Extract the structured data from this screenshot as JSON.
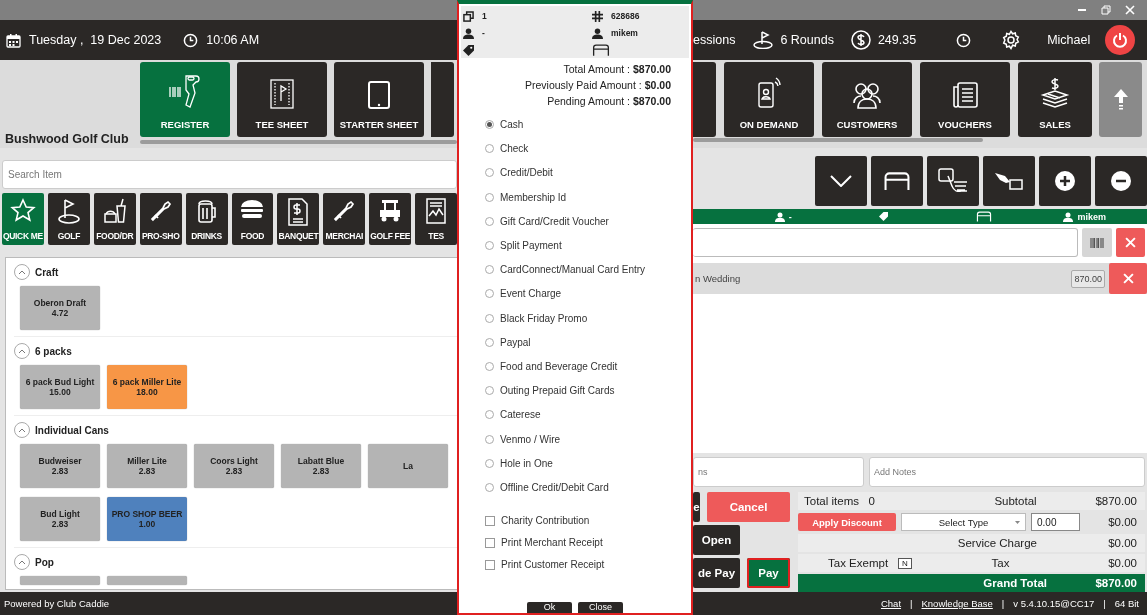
{
  "top_bar": {
    "date": "Tuesday ,  19 Dec 2023",
    "time": "10:06 AM",
    "sessions": "essions",
    "rounds": "6 Rounds",
    "balance": "249.35",
    "user": "Michael"
  },
  "club_name": "Bushwood Golf Club",
  "nav_left": [
    {
      "label": "REGISTER",
      "selected": true
    },
    {
      "label": "TEE SHEET",
      "selected": false
    },
    {
      "label": "STARTER SHEET",
      "selected": false
    }
  ],
  "nav_right": [
    {
      "label": "ON DEMAND",
      "selected": false
    },
    {
      "label": "CUSTOMERS",
      "selected": false
    },
    {
      "label": "VOUCHERS",
      "selected": false
    },
    {
      "label": "SALES",
      "selected": false
    }
  ],
  "search": {
    "placeholder": "Search Item"
  },
  "categories": [
    {
      "label": "QUICK ME",
      "selected": true
    },
    {
      "label": "GOLF",
      "selected": false
    },
    {
      "label": "FOOD/DR",
      "selected": false
    },
    {
      "label": "PRO-SHO",
      "selected": false
    },
    {
      "label": "DRINKS",
      "selected": false
    },
    {
      "label": "FOOD",
      "selected": false
    },
    {
      "label": "BANQUET",
      "selected": false
    },
    {
      "label": "MERCHAI",
      "selected": false
    },
    {
      "label": "GOLF FEE",
      "selected": false
    },
    {
      "label": "TES",
      "selected": false
    }
  ],
  "sections": [
    {
      "title": "Craft",
      "expanded": true,
      "items": [
        {
          "name": "Oberon Draft",
          "price": "4.72",
          "color": "#b4b4b4"
        }
      ]
    },
    {
      "title": "6 packs",
      "expanded": true,
      "items": [
        {
          "name": "6 pack Bud Light",
          "price": "15.00",
          "color": "#b4b4b4"
        },
        {
          "name": "6 pack Miller Lite",
          "price": "18.00",
          "color": "#f79646"
        }
      ]
    },
    {
      "title": "Individual Cans",
      "expanded": true,
      "items": [
        {
          "name": "Budweiser",
          "price": "2.83",
          "color": "#b4b4b4"
        },
        {
          "name": "Miller Lite",
          "price": "2.83",
          "color": "#b4b4b4"
        },
        {
          "name": "Coors Light",
          "price": "2.83",
          "color": "#b4b4b4"
        },
        {
          "name": "Labatt Blue",
          "price": "2.83",
          "color": "#b4b4b4"
        },
        {
          "name": "La",
          "color": "#b4b4b4"
        },
        {
          "name": "Bud Light",
          "price": "2.83",
          "color": "#b4b4b4"
        },
        {
          "name": "PRO SHOP BEER",
          "price": "1.00",
          "color": "#4f81bd"
        }
      ]
    },
    {
      "title": "Pop",
      "expanded": true,
      "items": [
        {
          "color": "#b4b4b4"
        },
        {
          "color": "#b4b4b4"
        }
      ]
    }
  ],
  "ticket_bar": {
    "customer": "-",
    "staff": "mikem"
  },
  "order_lines": [
    {
      "name": "n Wedding",
      "amount": "870.00"
    }
  ],
  "notes": [
    {
      "placeholder": "ns"
    },
    {
      "placeholder": "Add Notes"
    }
  ],
  "actions": [
    {
      "label": "e",
      "kind": "dark",
      "focused": false
    },
    {
      "label": "Cancel",
      "kind": "danger",
      "focused": false
    },
    {
      "label": "Open",
      "kind": "dark",
      "focused": false
    },
    {
      "label": "de Pay",
      "kind": "dark",
      "focused": false
    },
    {
      "label": "Pay",
      "kind": "primary",
      "focused": true
    }
  ],
  "summary": {
    "total_items_label": "Total items",
    "total_items": "0",
    "subtotal_label": "Subtotal",
    "subtotal": "$870.00",
    "discount_button": "Apply Discount",
    "discount_type": "Select Type",
    "discount_value": "0.00",
    "discount": "$0.00",
    "service_charge_label": "Service Charge",
    "service_charge": "$0.00",
    "tax_exempt_label": "Tax Exempt",
    "tax_exempt": "N",
    "tax_label": "Tax",
    "tax": "$0.00",
    "grand_total_label": "Grand Total",
    "grand_total": "$870.00"
  },
  "footer": {
    "powered_by": "Powered by Club Caddie",
    "items": [
      {
        "text": "Chat",
        "kind": "link"
      },
      {
        "text": "|",
        "kind": "sep"
      },
      {
        "text": "Knowledge Base",
        "kind": "link"
      },
      {
        "text": "|",
        "kind": "sep"
      },
      {
        "text": "v 5.4.10.15@CC17",
        "kind": "text"
      },
      {
        "text": "|",
        "kind": "sep"
      },
      {
        "text": "64 Bit",
        "kind": "text"
      }
    ]
  },
  "payment_modal": {
    "ticket": "1",
    "ticket_no": "628686",
    "customer": "-",
    "staff": "mikem",
    "amounts": [
      {
        "label": "Total Amount :",
        "value": "$870.00"
      },
      {
        "label": "Previously Paid Amount :",
        "value": "$0.00"
      },
      {
        "label": "Pending Amount :",
        "value": "$870.00"
      }
    ],
    "methods": [
      {
        "label": "Cash",
        "selected": true
      },
      {
        "label": "Check",
        "selected": false
      },
      {
        "label": "Credit/Debit",
        "selected": false
      },
      {
        "label": "Membership Id",
        "selected": false
      },
      {
        "label": "Gift Card/Credit Voucher",
        "selected": false
      },
      {
        "label": "Split Payment",
        "selected": false
      },
      {
        "label": "CardConnect/Manual Card Entry",
        "selected": false
      },
      {
        "label": "Event Charge",
        "selected": false
      },
      {
        "label": "Black Friday Promo",
        "selected": false
      },
      {
        "label": "Paypal",
        "selected": false
      },
      {
        "label": "Food and Beverage Credit",
        "selected": false
      },
      {
        "label": "Outing Prepaid Gift Cards",
        "selected": false
      },
      {
        "label": "Caterese",
        "selected": false
      },
      {
        "label": "Venmo / Wire",
        "selected": false
      },
      {
        "label": "Hole in One",
        "selected": false
      },
      {
        "label": "Offline Credit/Debit Card",
        "selected": false
      }
    ],
    "options": [
      {
        "label": "Charity Contribution",
        "checked": false
      },
      {
        "label": "Print Merchant Receipt",
        "checked": false
      },
      {
        "label": "Print Customer Receipt",
        "checked": false
      }
    ],
    "buttons": [
      "Ok",
      "Close"
    ]
  }
}
